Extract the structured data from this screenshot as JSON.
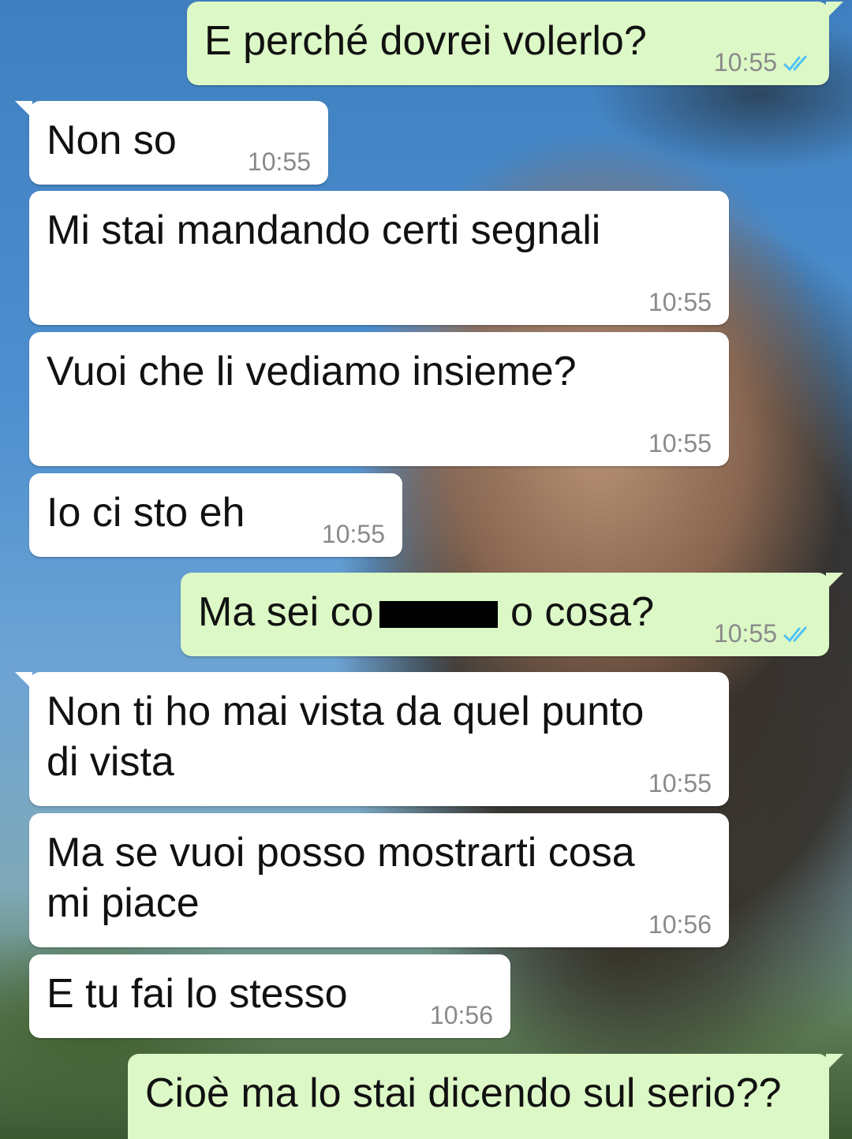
{
  "colors": {
    "incoming_bubble": "#ffffff",
    "outgoing_bubble": "#dcf8c6",
    "time_text": "#8a8a8a",
    "read_ticks": "#4fc3f7"
  },
  "messages": [
    {
      "text": "E perché dovrei volerlo?",
      "time": "10:55",
      "direction": "outgoing",
      "status": "read"
    },
    {
      "text": "Non so",
      "time": "10:55",
      "direction": "incoming"
    },
    {
      "text": "Mi stai mandando certi segnali",
      "time": "10:55",
      "direction": "incoming"
    },
    {
      "text": "Vuoi che li vediamo insieme?",
      "time": "10:55",
      "direction": "incoming"
    },
    {
      "text": "Io ci sto eh",
      "time": "10:55",
      "direction": "incoming"
    },
    {
      "text": "Ma sei co",
      "text_after": "o cosa?",
      "time": "10:55",
      "direction": "outgoing",
      "status": "read",
      "redacted": true
    },
    {
      "text": "Non ti ho mai vista da quel punto\ndi vista",
      "time": "10:55",
      "direction": "incoming"
    },
    {
      "text": "Ma se vuoi posso mostrarti cosa\nmi piace",
      "time": "10:56",
      "direction": "incoming"
    },
    {
      "text": "E tu fai lo stesso",
      "time": "10:56",
      "direction": "incoming"
    },
    {
      "text": "Cioè ma lo stai dicendo sul serio??",
      "direction": "outgoing"
    }
  ],
  "icons": {
    "read_status": "double-check-icon"
  }
}
